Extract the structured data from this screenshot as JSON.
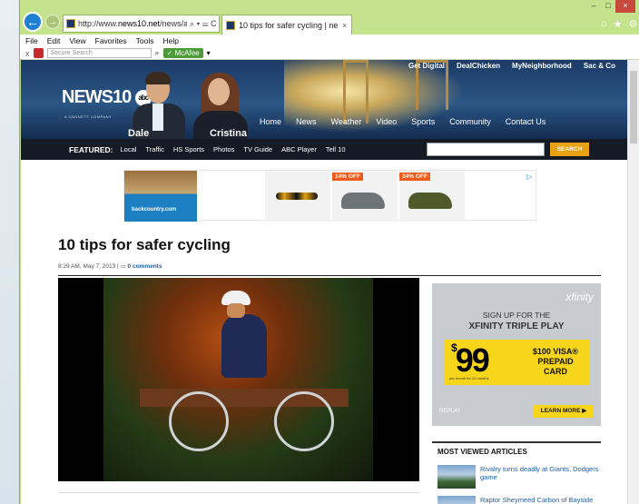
{
  "browser": {
    "url_prefix": "http://www.",
    "url_domain": "news10.net",
    "url_suffix": "/news/artic",
    "addr_tools": "⌕ ▾ ☰ C",
    "tab_title": "10 tips for safer cycling | ne...",
    "tab_close": "×",
    "win_min": "–",
    "win_max": "□",
    "win_close": "×",
    "icons": [
      "home-icon",
      "star-icon",
      "gear-icon"
    ],
    "icon_glyphs": [
      "⌂",
      "★",
      "⚙"
    ],
    "menu": [
      "File",
      "Edit",
      "View",
      "Favorites",
      "Tools",
      "Help"
    ],
    "toolbar": {
      "close_glyph": "x",
      "search_placeholder": "Secure Search",
      "search_glyph": "⌕",
      "mcafee": "McAfee",
      "mcafee_check": "✓",
      "dropdown": "▾"
    }
  },
  "site": {
    "logo_text": "NEWS10",
    "logo_abc": "abc",
    "gannett": "A GANNETT COMPANY",
    "anchor_left": "Dale",
    "anchor_right": "Cristina",
    "top_links": [
      "Get Digital",
      "DealChicken",
      "MyNeighborhood",
      "Sac & Co"
    ],
    "main_nav": [
      "Home",
      "News",
      "Weather",
      "Video",
      "Sports",
      "Community",
      "Contact Us"
    ],
    "featured_label": "FEATURED:",
    "featured_links": [
      "Local",
      "Traffic",
      "HS Sports",
      "Photos",
      "TV Guide",
      "ABC Player",
      "Tell 10"
    ],
    "search_button": "SEARCH"
  },
  "ad": {
    "brand": "backcountry.com",
    "badge1": "14% OFF",
    "badge2": "34% OFF",
    "choices_glyph": "▷"
  },
  "article": {
    "title": "10 tips for safer cycling",
    "date": "8:29 AM, May 7, 2013",
    "separator": "|",
    "comments": "0 comments"
  },
  "sidead": {
    "logo": "xfinity",
    "line1": "SIGN UP FOR THE",
    "line2": "XFINITY TRIPLE PLAY",
    "price": "99",
    "dollar": "$",
    "visa": "$100 VISA® PREPAID CARD",
    "fine": "per month for 12 months",
    "replay": "REPLAY",
    "learn": "LEARN MORE ▶"
  },
  "most_viewed": {
    "title": "MOST VIEWED ARTICLES",
    "items": [
      "Rivalry turns deadly at Giants, Dodgers game",
      "Raptor Sheymeed Carbon of Bayside"
    ]
  }
}
